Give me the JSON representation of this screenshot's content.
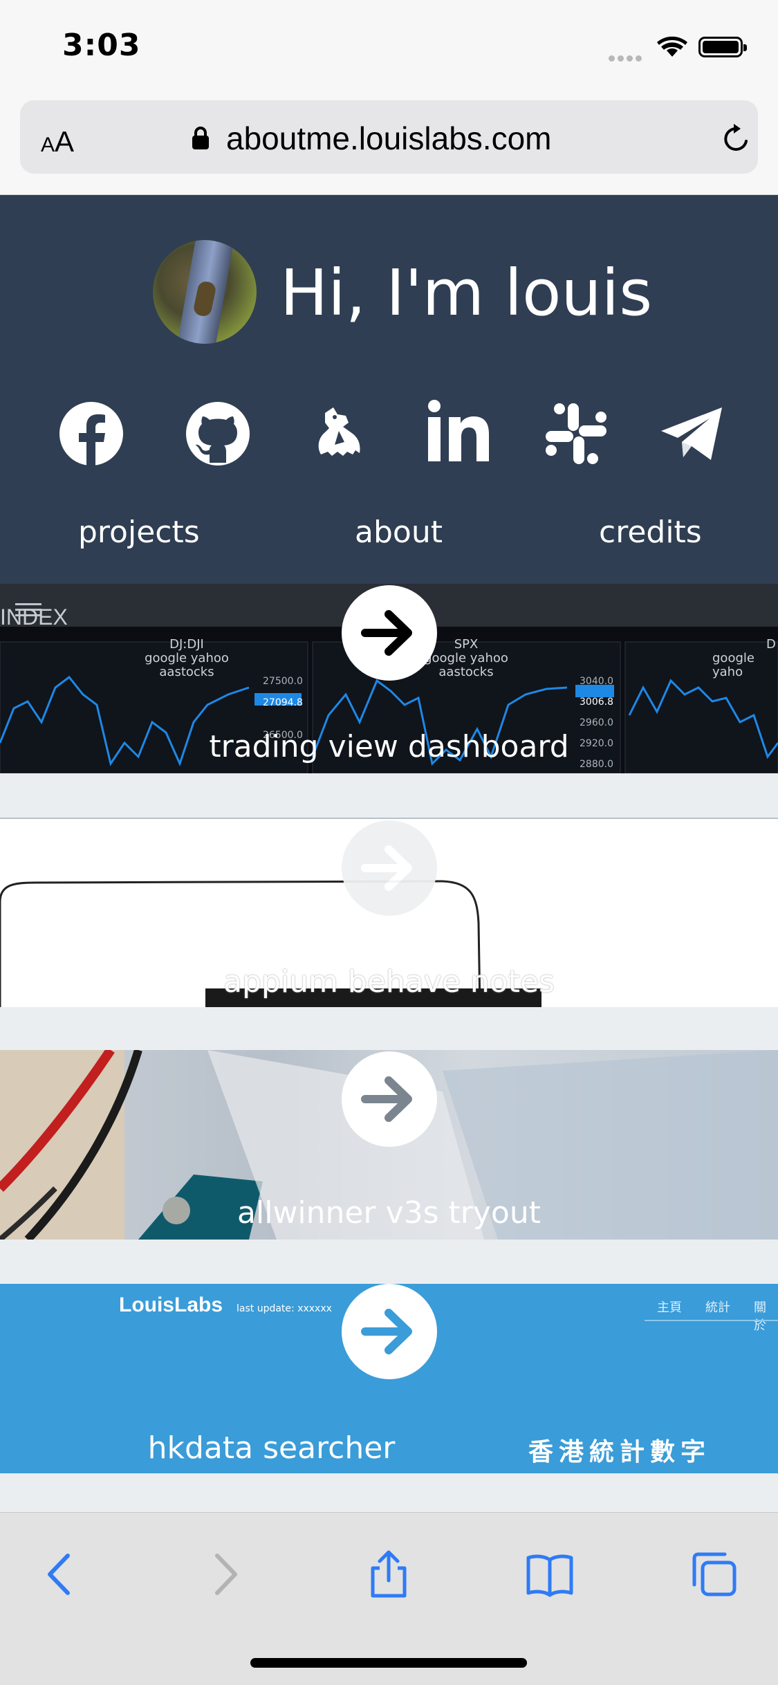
{
  "status_bar": {
    "time": "3:03"
  },
  "browser": {
    "text_size_label_small": "A",
    "text_size_label_large": "A",
    "url": "aboutme.louislabs.com"
  },
  "hero": {
    "greeting": "Hi, I'm louis",
    "social_icons": [
      "facebook-icon",
      "github-icon",
      "docker-bird-icon",
      "linkedin-icon",
      "slack-icon",
      "telegram-icon"
    ],
    "nav": {
      "projects": "projects",
      "about": "about",
      "credits": "credits"
    }
  },
  "projects": [
    {
      "title": "trading view dashboard",
      "thumb": {
        "index_label": "INDEX",
        "panels": [
          {
            "name": "DJ:DJI",
            "sources": "google yahoo aastocks",
            "ticks": [
              "27500.0",
              "27094.8",
              "26500.0"
            ]
          },
          {
            "name": "SPX",
            "sources": "google yahoo aastocks",
            "ticks": [
              "3040.0",
              "3006.8",
              "2960.0",
              "2920.0",
              "2880.0"
            ]
          },
          {
            "name": "D",
            "sources": "google yaho",
            "ticks": []
          }
        ]
      }
    },
    {
      "title": "appium behave notes"
    },
    {
      "title": "allwinner v3s tryout"
    },
    {
      "title": "hkdata searcher",
      "thumb": {
        "brand": "LouisLabs",
        "last_update": "last update: xxxxxx",
        "tagline": "香港統計數字",
        "nav": [
          "主頁",
          "統計",
          "關於"
        ]
      }
    }
  ],
  "colors": {
    "hero_bg": "#2f3e52",
    "card_gap": "#ebeef0",
    "ios_blue": "#2f7bf6",
    "hkdata_blue": "#3a9cd8"
  }
}
